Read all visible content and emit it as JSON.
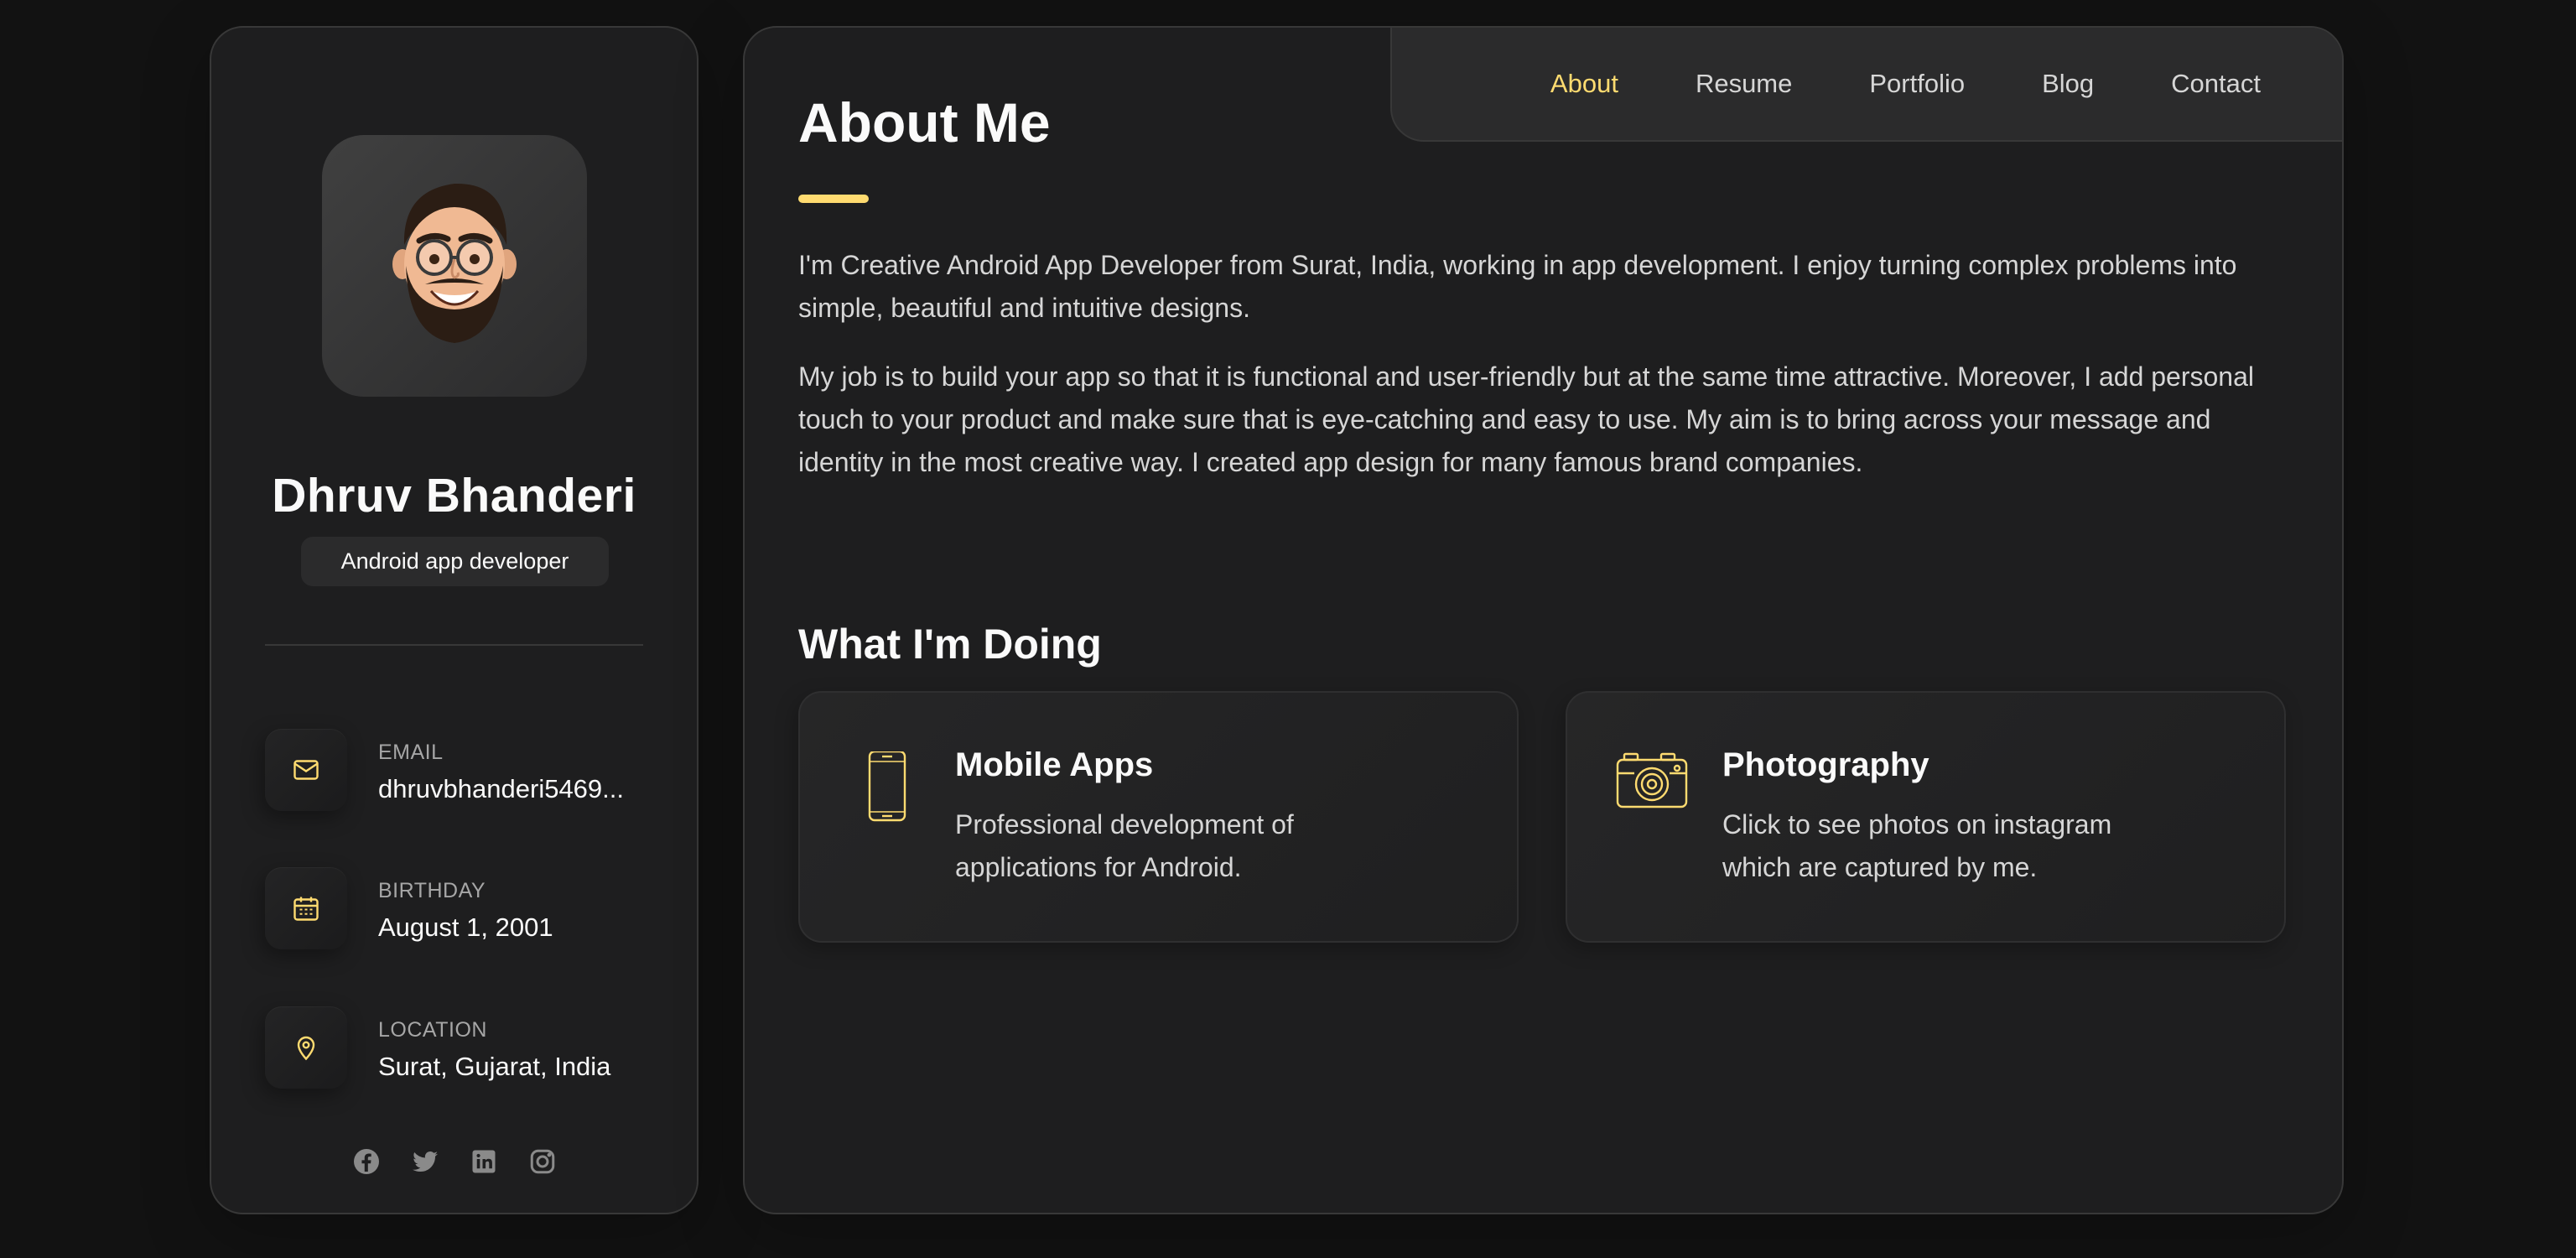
{
  "sidebar": {
    "name": "Dhruv Bhanderi",
    "title": "Android app developer",
    "contacts": [
      {
        "label": "EMAIL",
        "value": "dhruvbhanderi5469...",
        "icon": "mail-icon"
      },
      {
        "label": "BIRTHDAY",
        "value": "August 1, 2001",
        "icon": "calendar-icon"
      },
      {
        "label": "LOCATION",
        "value": "Surat, Gujarat, India",
        "icon": "location-pin-icon"
      }
    ],
    "socials": [
      "facebook-icon",
      "twitter-icon",
      "linkedin-icon",
      "instagram-icon"
    ]
  },
  "nav": {
    "items": [
      "About",
      "Resume",
      "Portfolio",
      "Blog",
      "Contact"
    ],
    "active": "About"
  },
  "about": {
    "title": "About Me",
    "paragraphs": [
      "I'm Creative Android App Developer from Surat, India, working in app development. I enjoy turning complex problems into simple, beautiful and intuitive designs.",
      "My job is to build your app so that it is functional and user-friendly but at the same time attractive. Moreover, I add personal touch to your product and make sure that is eye-catching and easy to use. My aim is to bring across your message and identity in the most creative way. I created app design for many famous brand companies."
    ]
  },
  "services": {
    "title": "What I'm Doing",
    "items": [
      {
        "title": "Mobile Apps",
        "description": "Professional development of applications for Android.",
        "icon": "mobile-phone-icon"
      },
      {
        "title": "Photography",
        "description": "Click to see photos on instagram which are captured by me.",
        "icon": "camera-icon"
      }
    ]
  },
  "colors": {
    "accent": "#ffdb70",
    "background": "#121212",
    "card": "#1e1e1f",
    "border": "#383838",
    "text": "#fafafa",
    "muted_text": "#d6d6d6"
  }
}
